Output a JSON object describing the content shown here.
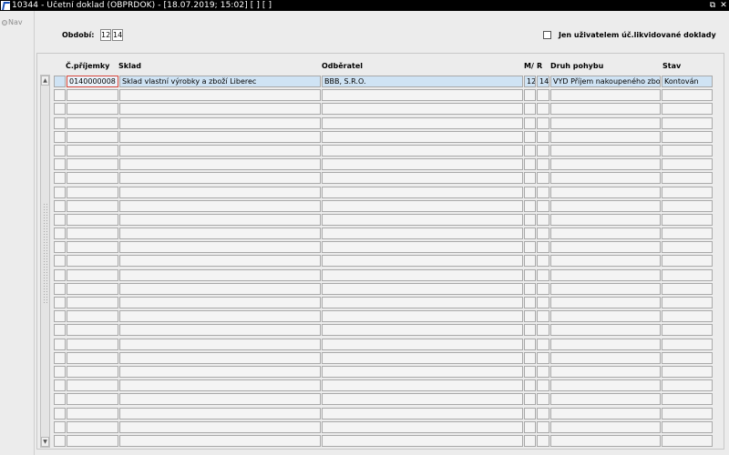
{
  "window": {
    "title": "10344 - Účetní doklad (OBPRDOK) - [18.07.2019; 15:02]  [ ]  [ ]",
    "restore_glyph": "⧉",
    "close_glyph": "✕"
  },
  "sidebar": {
    "nav_label": "Nav"
  },
  "filters": {
    "period_label": "Období:",
    "period_month": "12",
    "period_year": "14",
    "only_user_label": "Jen uživatelem úč.likvidované doklady",
    "only_user_checked": false
  },
  "table": {
    "columns": [
      "Č.příjemky",
      "Sklad",
      "Odběratel",
      "M/",
      "R",
      "Druh pohybu",
      "Stav"
    ],
    "rows": [
      [
        "0140000008",
        "Sklad vlastní výrobky a zboží Liberec",
        "BBB, S.R.O.",
        "12",
        "14",
        "VYD Příjem nakoupeného zboží *",
        "Kontován"
      ]
    ],
    "total_row_count": 27,
    "selected_row": 0
  },
  "scrollbar": {
    "up_glyph": "▲",
    "down_glyph": "▼"
  },
  "colors": {
    "title_bar": "#000000",
    "selected_row": "#cfe3f4",
    "focus_border": "#d6453a",
    "background": "#ececec"
  }
}
